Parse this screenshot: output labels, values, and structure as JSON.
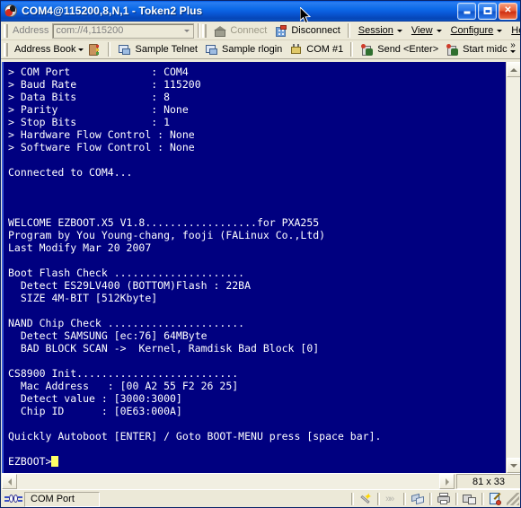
{
  "window": {
    "title": "COM4@115200,8,N,1 - Token2 Plus",
    "icon": "app-logo-icon",
    "minimize_label": "Minimize",
    "maximize_label": "Maximize",
    "close_label": "Close"
  },
  "toolbar_top": {
    "address_label": "Address",
    "address_value": "com://4,115200",
    "connect_label": "Connect",
    "disconnect_label": "Disconnect",
    "menus": [
      {
        "label": "Session"
      },
      {
        "label": "View"
      },
      {
        "label": "Configure"
      },
      {
        "label": "Help"
      }
    ]
  },
  "toolbar_second": {
    "address_book_label": "Address Book",
    "buttons": [
      {
        "label": "Sample Telnet",
        "icon": "terminal-icon"
      },
      {
        "label": "Sample rlogin",
        "icon": "terminal-icon"
      },
      {
        "label": "COM #1",
        "icon": "serial-port-icon"
      },
      {
        "label": "Send <Enter>",
        "icon": "send-icon"
      },
      {
        "label": "Start midc",
        "icon": "send-icon"
      }
    ],
    "overflow_label": "More buttons"
  },
  "terminal": {
    "background_color": "#000080",
    "foreground_color": "#ffffff",
    "cursor_color": "#ffff66",
    "prompt": "EZBOOT>",
    "content": "> COM Port             : COM4\n> Baud Rate            : 115200\n> Data Bits            : 8\n> Parity               : None\n> Stop Bits            : 1\n> Hardware Flow Control : None\n> Software Flow Control : None\n\nConnected to COM4...\n\n\n\nWELCOME EZBOOT.X5 V1.8..................for PXA255\nProgram by You Young-chang, fooji (FALinux Co.,Ltd)\nLast Modify Mar 20 2007\n\nBoot Flash Check .....................\n  Detect ES29LV400 (BOTTOM)Flash : 22BA\n  SIZE 4M-BIT [512Kbyte]\n\nNAND Chip Check ......................\n  Detect SAMSUNG [ec:76] 64MByte\n  BAD BLOCK SCAN ->  Kernel, Ramdisk Bad Block [0]\n\nCS8900 Init..........................\n  Mac Address   : [00 A2 55 F2 26 25]\n  Detect value : [3000:3000]\n  Chip ID      : [0E63:000A]\n\nQuickly Autoboot [ENTER] / Goto BOOT-MENU press [space bar].\n\n"
  },
  "scrollbars": {
    "up_label": "Scroll up",
    "down_label": "Scroll down",
    "left_label": "Scroll left",
    "right_label": "Scroll right"
  },
  "status": {
    "size_indicator": "81 x 33",
    "connection_label": "COM Port",
    "icons": [
      {
        "name": "wand-icon"
      },
      {
        "name": "fast-forward-icon"
      },
      {
        "name": "transfer-icon"
      },
      {
        "name": "print-icon"
      },
      {
        "name": "lock-icon"
      },
      {
        "name": "edit-icon"
      }
    ]
  }
}
